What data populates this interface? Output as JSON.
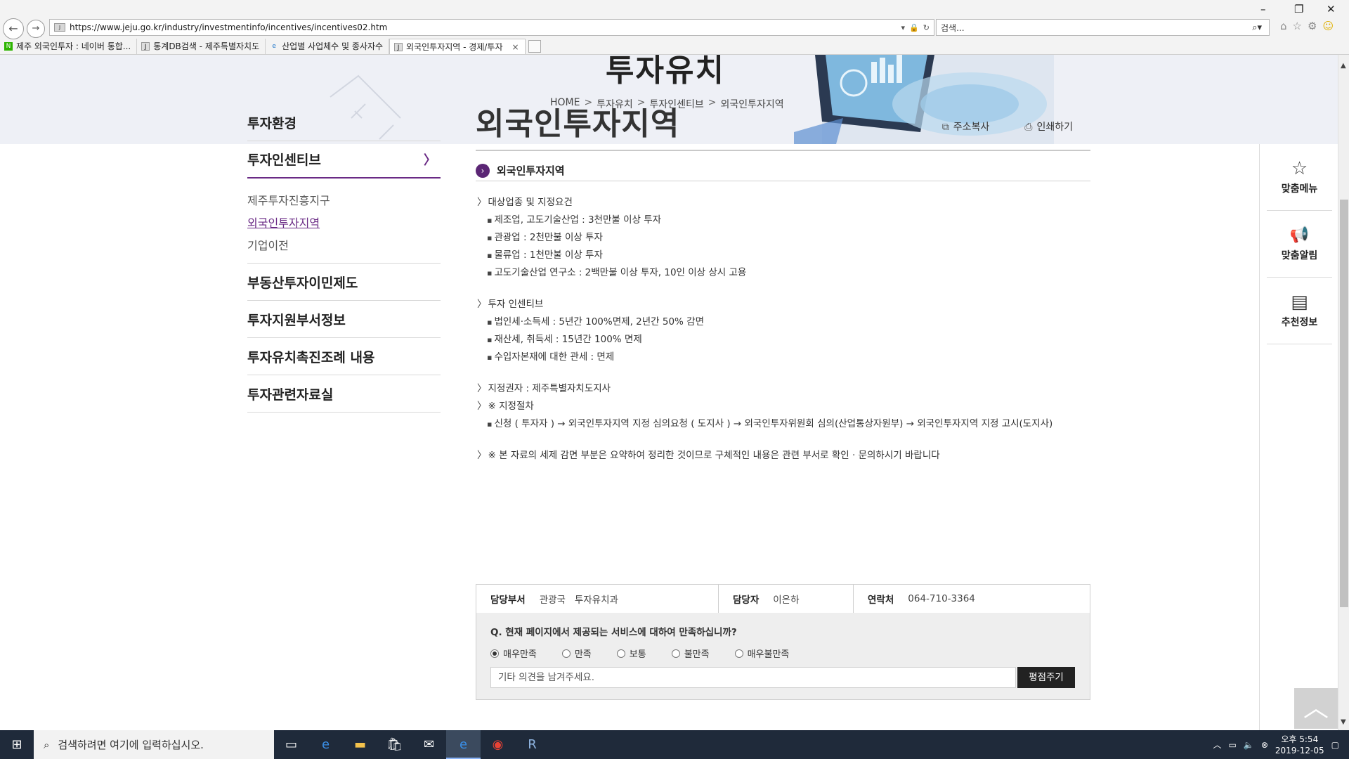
{
  "browser": {
    "url": "https://www.jeju.go.kr/industry/investmentinfo/incentives/incentives02.htm",
    "search_placeholder": "검색...",
    "tabs": [
      {
        "label": "제주 외국인투자 : 네이버 통합...",
        "favicon": "N"
      },
      {
        "label": "통계DB검색 - 제주특별자치도",
        "favicon": "J"
      },
      {
        "label": "산업별 사업체수 및 종사자수",
        "favicon": "e"
      },
      {
        "label": "외국인투자지역 - 경제/투자",
        "favicon": "J"
      }
    ],
    "tab_close": "×"
  },
  "banner": {
    "title": "투자유치",
    "breadcrumb": [
      "HOME",
      "투자유치",
      "투자인센티브",
      "외국인투자지역"
    ],
    "sep": ">"
  },
  "lnb": {
    "items": [
      "투자환경",
      "투자인센티브",
      "부동산투자이민제도",
      "투자지원부서정보",
      "투자유치촉진조례 내용",
      "투자관련자료실"
    ],
    "active_arrow": "〉",
    "sub": [
      "제주투자진흥지구",
      "외국인투자지역",
      "기업이전"
    ]
  },
  "content": {
    "title": "외국인투자지역",
    "copy_label": "주소복사",
    "print_label": "인쇄하기",
    "section_title": "외국인투자지역",
    "h1": "대상업종 및 지정요건",
    "h1_items": [
      "제조업, 고도기술산업 : 3천만불 이상 투자",
      "관광업 : 2천만불 이상 투자",
      "물류업 : 1천만불 이상 투자",
      "고도기술산업 연구소 : 2백만불 이상 투자, 10인 이상 상시 고용"
    ],
    "h2": "투자 인센티브",
    "h2_items": [
      "법인세·소득세 : 5년간 100%면제, 2년간 50% 감면",
      "재산세, 취득세 : 15년간 100% 면제",
      "수입자본재에 대한 관세 : 면제"
    ],
    "h3": "지정권자 : 제주특별자치도지사",
    "h4": "※ 지정절차",
    "h4_items": [
      "신청 ( 투자자 ) → 외국인투자지역 지정 심의요청 ( 도지사 ) → 외국인투자위원회 심의(산업통상자원부) → 외국인투자지역 지정 고시(도지사)"
    ],
    "h5": "※ 본 자료의 세제 감면 부분은 요약하여 정리한 것이므로 구체적인 내용은 관련 부서로 확인 · 문의하시기 바랍니다"
  },
  "info": {
    "dept_label": "담당부서",
    "dept_value": "관광국   투자유치과",
    "person_label": "담당자",
    "person_value": "이은하",
    "contact_label": "연락처",
    "contact_value": "064-710-3364"
  },
  "survey": {
    "question": "Q. 현재 페이지에서 제공되는 서비스에 대하여 만족하십니까?",
    "options": [
      "매우만족",
      "만족",
      "보통",
      "불만족",
      "매우불만족"
    ],
    "selected": "매우만족",
    "comment_placeholder": "기타 의견을 남겨주세요.",
    "submit_label": "평점주기"
  },
  "quick": {
    "items": [
      {
        "label": "맞춤메뉴",
        "icon": "star-gear-icon",
        "glyph": "☆"
      },
      {
        "label": "맞춤알림",
        "icon": "megaphone-icon",
        "glyph": "📢"
      },
      {
        "label": "추천정보",
        "icon": "document-icon",
        "glyph": "▤"
      }
    ]
  },
  "taskbar": {
    "search_placeholder": "검색하려면 여기에 입력하십시오.",
    "time": "오후 5:54",
    "date": "2019-12-05"
  }
}
